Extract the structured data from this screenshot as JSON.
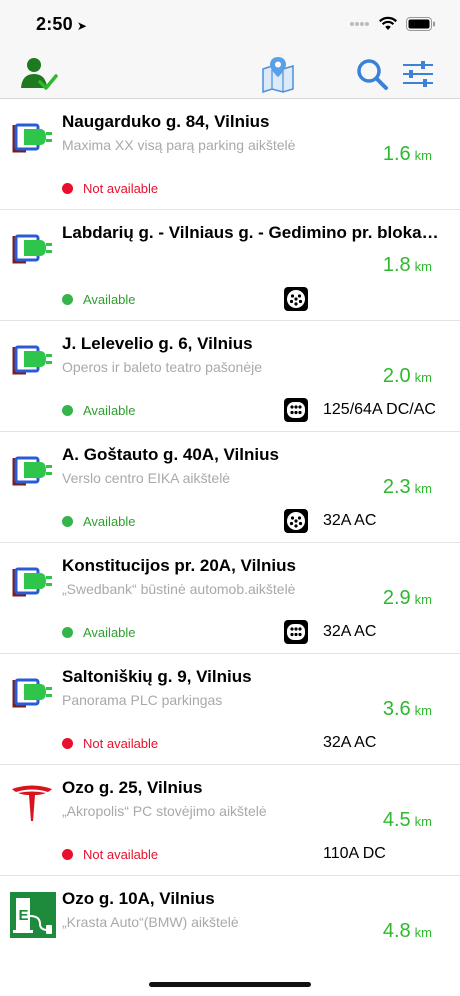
{
  "status_bar": {
    "time": "2:50"
  },
  "toolbar": {
    "icons": [
      "user-check-icon",
      "map-icon",
      "search-icon",
      "filter-sliders-icon"
    ]
  },
  "colors": {
    "green": "#2fb82f",
    "red": "#e8102c",
    "blue": "#3b82d6"
  },
  "stations": [
    {
      "title": "Naugarduko g. 84, Vilnius",
      "subtitle": "Maxima XX visą parą parking aikštelė",
      "distance": "1.6",
      "unit": "km",
      "status": "Not available",
      "available": false,
      "connector": null,
      "power": "",
      "brand": "ev-charger-icon"
    },
    {
      "title": "Labdarių g. - Vilniaus g. - Gedimino pr. blokas,...",
      "subtitle": "",
      "distance": "1.8",
      "unit": "km",
      "status": "Available",
      "available": true,
      "connector": "type2-connector-icon",
      "power": "",
      "brand": "ev-charger-icon"
    },
    {
      "title": "J. Lelevelio g. 6, Vilnius",
      "subtitle": "Operos ir baleto teatro pašonėje",
      "distance": "2.0",
      "unit": "km",
      "status": "Available",
      "available": true,
      "connector": "ccs-connector-icon",
      "power": "125/64A DC/AC",
      "brand": "ev-charger-icon"
    },
    {
      "title": "A. Goštauto g. 40A, Vilnius",
      "subtitle": "Verslo centro EIKA aikštelė",
      "distance": "2.3",
      "unit": "km",
      "status": "Available",
      "available": true,
      "connector": "type2-connector-icon",
      "power": "32A AC",
      "brand": "ev-charger-icon"
    },
    {
      "title": "Konstitucijos pr. 20A, Vilnius",
      "subtitle": "„Swedbank“ būstinė automob.aikštelė",
      "distance": "2.9",
      "unit": "km",
      "status": "Available",
      "available": true,
      "connector": "ccs-connector-icon",
      "power": "32A AC",
      "brand": "ev-charger-icon"
    },
    {
      "title": "Saltoniškių g. 9, Vilnius",
      "subtitle": "Panorama PLC parkingas",
      "distance": "3.6",
      "unit": "km",
      "status": "Not available",
      "available": false,
      "connector": null,
      "power": "32A AC",
      "brand": "ev-charger-icon"
    },
    {
      "title": "Ozo g. 25, Vilnius",
      "subtitle": "„Akropolis“ PC stovėjimo aikštelė",
      "distance": "4.5",
      "unit": "km",
      "status": "Not available",
      "available": false,
      "connector": null,
      "power": "110A DC",
      "brand": "tesla-logo-icon"
    },
    {
      "title": "Ozo g. 10A, Vilnius",
      "subtitle": "„Krasta Auto“(BMW) aikštelė",
      "distance": "4.8",
      "unit": "km",
      "status": "",
      "available": null,
      "connector": null,
      "power": "",
      "brand": "e-station-icon"
    }
  ]
}
